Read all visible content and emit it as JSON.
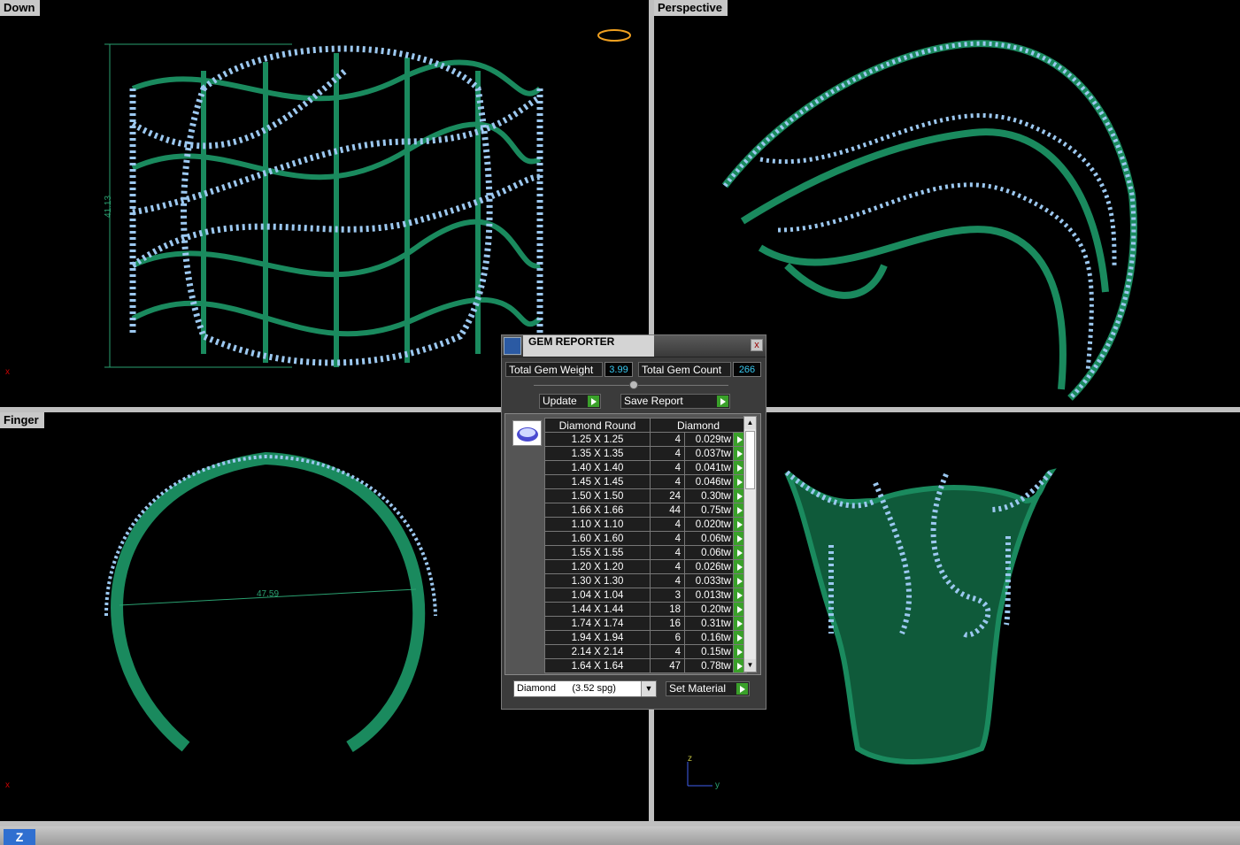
{
  "viewports": {
    "top_left": {
      "label": "Down",
      "dimension": "41.13",
      "axis": "x"
    },
    "top_right": {
      "label": "Perspective"
    },
    "bottom_left": {
      "label": "Finger",
      "dimension": "47.59",
      "axis": "x"
    },
    "bottom_right": {
      "axis_z": "z",
      "axis_y": "y"
    }
  },
  "gem_reporter": {
    "title": "GEM REPORTER",
    "close": "x",
    "total_weight_label": "Total Gem Weight",
    "total_weight_value": "3.99",
    "total_count_label": "Total Gem Count",
    "total_count_value": "266",
    "update_label": "Update",
    "save_report_label": "Save Report",
    "table": {
      "col_shape": "Diamond Round",
      "col_material": "Diamond",
      "rows": [
        {
          "size": "1.25 X 1.25",
          "count": "4",
          "weight": "0.029tw"
        },
        {
          "size": "1.35 X 1.35",
          "count": "4",
          "weight": "0.037tw"
        },
        {
          "size": "1.40 X 1.40",
          "count": "4",
          "weight": "0.041tw"
        },
        {
          "size": "1.45 X 1.45",
          "count": "4",
          "weight": "0.046tw"
        },
        {
          "size": "1.50 X 1.50",
          "count": "24",
          "weight": "0.30tw"
        },
        {
          "size": "1.66 X 1.66",
          "count": "44",
          "weight": "0.75tw"
        },
        {
          "size": "1.10 X 1.10",
          "count": "4",
          "weight": "0.020tw"
        },
        {
          "size": "1.60 X 1.60",
          "count": "4",
          "weight": "0.06tw"
        },
        {
          "size": "1.55 X 1.55",
          "count": "4",
          "weight": "0.06tw"
        },
        {
          "size": "1.20 X 1.20",
          "count": "4",
          "weight": "0.026tw"
        },
        {
          "size": "1.30 X 1.30",
          "count": "4",
          "weight": "0.033tw"
        },
        {
          "size": "1.04 X 1.04",
          "count": "3",
          "weight": "0.013tw"
        },
        {
          "size": "1.44 X 1.44",
          "count": "18",
          "weight": "0.20tw"
        },
        {
          "size": "1.74 X 1.74",
          "count": "16",
          "weight": "0.31tw"
        },
        {
          "size": "1.94 X 1.94",
          "count": "6",
          "weight": "0.16tw"
        },
        {
          "size": "2.14 X 2.14",
          "count": "4",
          "weight": "0.15tw"
        },
        {
          "size": "1.64 X 1.64",
          "count": "47",
          "weight": "0.78tw"
        }
      ]
    },
    "material_select": "Diamond      (3.52 spg)",
    "set_material_label": "Set Material"
  },
  "colors": {
    "metal": "#1a8a5e",
    "gem": "#9cc8f0"
  }
}
